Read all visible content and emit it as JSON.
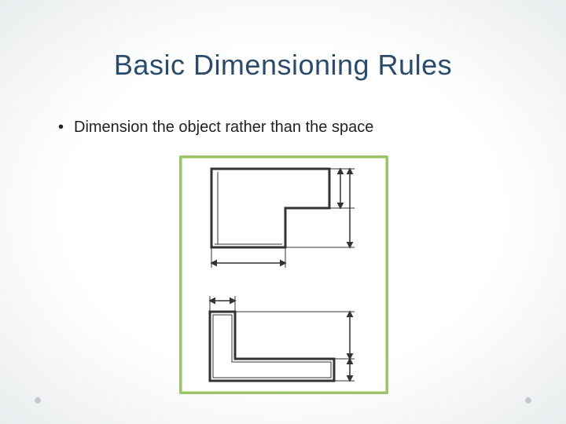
{
  "title": "Basic Dimensioning Rules",
  "bullets": [
    "Dimension the object rather than the space"
  ],
  "figure": {
    "alt": "Two dimensioning examples showing an L-shaped object. Top example dimensions the object features; bottom example dimensions the gap/space. Illustrates preferring object dimensions over space dimensions."
  },
  "colors": {
    "title": "#2a4b6b",
    "frame_border": "#9bc46a"
  }
}
